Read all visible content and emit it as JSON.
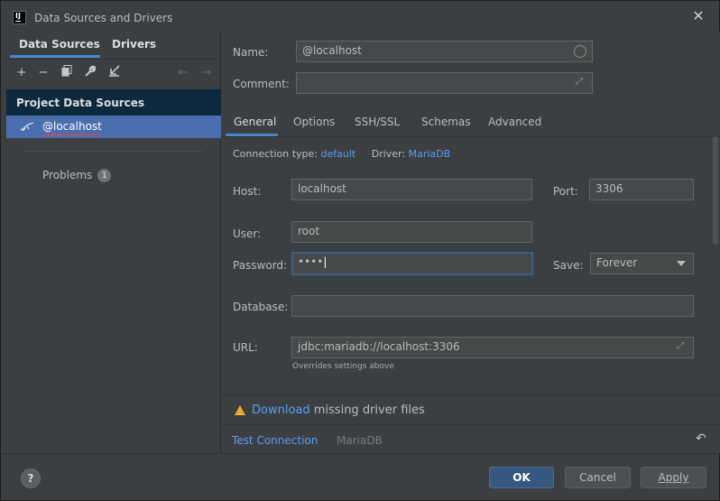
{
  "window": {
    "title": "Data Sources and Drivers"
  },
  "left": {
    "tabs": [
      "Data Sources",
      "Drivers"
    ],
    "section": "Project Data Sources",
    "selected_item": "@localhost",
    "problems_label": "Problems",
    "problems_count": "1"
  },
  "form": {
    "name_label": "Name:",
    "name_value": "@localhost",
    "comment_label": "Comment:",
    "comment_value": "",
    "tabs": [
      "General",
      "Options",
      "SSH/SSL",
      "Schemas",
      "Advanced"
    ],
    "conn_type_label": "Connection type:",
    "conn_type_value": "default",
    "driver_label": "Driver:",
    "driver_value": "MariaDB",
    "host_label": "Host:",
    "host_value": "localhost",
    "port_label": "Port:",
    "port_value": "3306",
    "user_label": "User:",
    "user_value": "root",
    "password_label": "Password:",
    "password_value": "••••",
    "save_label": "Save:",
    "save_value": "Forever",
    "database_label": "Database:",
    "database_value": "",
    "url_label": "URL:",
    "url_value": "jdbc:mariadb://localhost:3306",
    "url_hint": "Overrides settings above",
    "warn_link": "Download",
    "warn_text": " missing driver files",
    "test_connection": "Test Connection",
    "driver_name": "MariaDB"
  },
  "footer": {
    "help": "?",
    "ok": "OK",
    "cancel": "Cancel",
    "apply": "Apply"
  }
}
